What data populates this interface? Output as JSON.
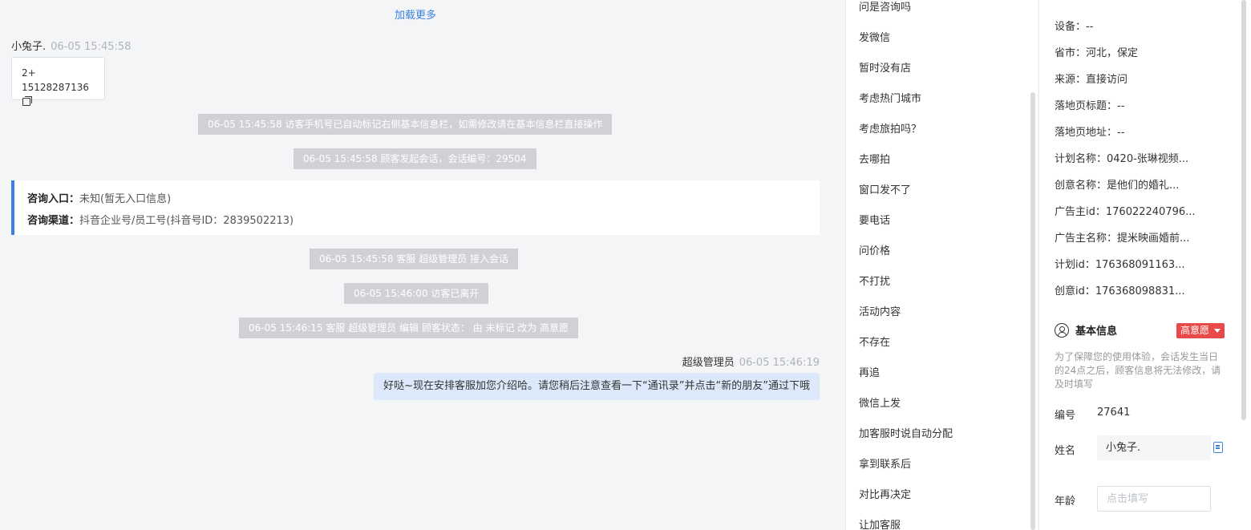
{
  "chat": {
    "load_more": "加载更多",
    "visitor": {
      "name": "小兔子.",
      "time": "06-05 15:45:58",
      "line1": "2+",
      "line2": "15128287136"
    },
    "system_msgs": [
      "06-05 15:45:58 访客手机号已自动标记右侧基本信息栏，如需修改请在基本信息栏直接操作",
      "06-05 15:45:58 顾客发起会话，会话编号：29504",
      "06-05 15:45:58 客服 超级管理员 接入会话",
      "06-05 15:46:00 访客已离开",
      "06-05 15:46:15 客服 超级管理员 编辑 顾客状态： 由 未标记 改为 高意愿"
    ],
    "entry": {
      "entry_label": "咨询入口：",
      "entry_value": "未知(暂无入口信息)",
      "channel_label": "咨询渠道：",
      "channel_value": "抖音企业号/员工号(抖音号ID：2839502213)"
    },
    "agent": {
      "name": "超级管理员",
      "time": "06-05 15:46:19",
      "message": "好哒~现在安排客服加您介绍哈。请您稍后注意查看一下“通讯录”并点击“新的朋友”通过下哦"
    }
  },
  "quick_replies": [
    "问是咨询吗",
    "发微信",
    "暂时没有店",
    "考虑热门城市",
    "考虑旅拍吗？",
    "去哪拍",
    "窗口发不了",
    "要电话",
    "问价格",
    "不打扰",
    "活动内容",
    "不存在",
    "再追",
    "微信上发",
    "加客服时说自动分配",
    "拿到联系后",
    "对比再决定",
    "让加客服"
  ],
  "visitor_info": [
    {
      "label": "设备：",
      "value": "--"
    },
    {
      "label": "省市：",
      "value": "河北，保定"
    },
    {
      "label": "来源：",
      "value": "直接访问"
    },
    {
      "label": "落地页标题：",
      "value": "--"
    },
    {
      "label": "落地页地址：",
      "value": "--"
    },
    {
      "label": "计划名称：",
      "value": "0420-张琳视频..."
    },
    {
      "label": "创意名称：",
      "value": "是他们的婚礼..."
    },
    {
      "label": "广告主id：",
      "value": "176022240796..."
    },
    {
      "label": "广告主名称：",
      "value": "提米映画婚前..."
    },
    {
      "label": "计划id：",
      "value": "176368091163..."
    },
    {
      "label": "创意id：",
      "value": "176368098831..."
    }
  ],
  "basic_info": {
    "title": "基本信息",
    "intent": "高意愿",
    "notice": "为了保障您的使用体验，会话发生当日的24点之后，顾客信息将无法修改，请及时填写",
    "id_label": "编号",
    "id_value": "27641",
    "name_label": "姓名",
    "name_value": "小兔子.",
    "age_label": "年龄",
    "age_placeholder": "点击填写"
  },
  "colors": {
    "accent": "#3b82e0",
    "badge": "#e84a4a",
    "system_bg": "#cfd1d5",
    "agent_bubble": "#dbe9fb"
  }
}
